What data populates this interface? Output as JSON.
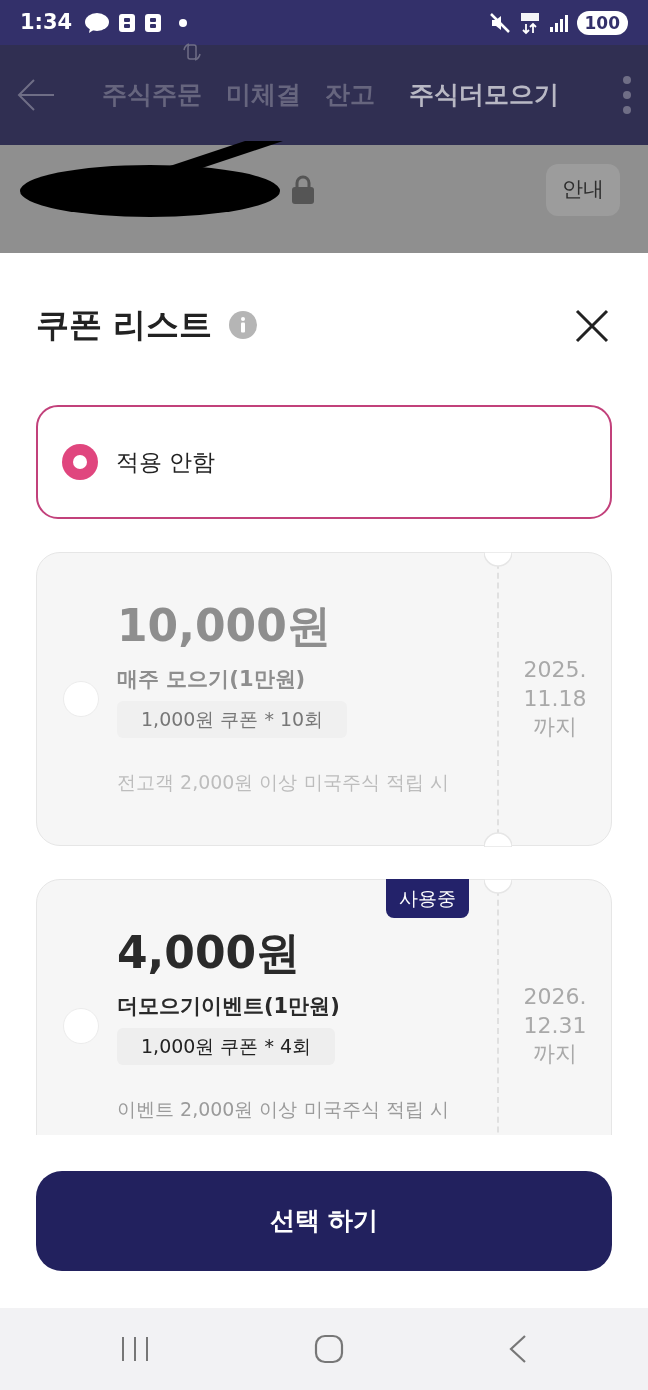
{
  "status_bar": {
    "time": "1:34",
    "battery": "100"
  },
  "app_bar": {
    "tabs": [
      {
        "label": "주식주문",
        "selected": false
      },
      {
        "label": "미체결",
        "selected": false
      },
      {
        "label": "잔고",
        "selected": false
      },
      {
        "label": "주식더모으기",
        "selected": true
      }
    ]
  },
  "info_bar": {
    "button": "안내"
  },
  "sheet": {
    "title": "쿠폰 리스트",
    "options": [
      {
        "kind": "none",
        "label": "적용 안함",
        "selected": true
      },
      {
        "kind": "coupon",
        "amount": "10,000원",
        "name": "매주 모으기(1만원)",
        "detail": "1,000원 쿠폰 * 10회",
        "condition": "전고객 2,000원 이상 미국주식 적립 시",
        "expiry": [
          "2025.",
          "11.18",
          "까지"
        ],
        "disabled": true,
        "selected": false
      },
      {
        "kind": "coupon",
        "amount": "4,000원",
        "name": "더모으기이벤트(1만원)",
        "detail": "1,000원 쿠폰 * 4회",
        "condition": "이벤트 2,000원 이상 미국주식 적립 시",
        "expiry": [
          "2026.",
          "12.31",
          "까지"
        ],
        "badge": "사용중",
        "disabled": false,
        "selected": false
      }
    ],
    "submit": "선택 하기"
  }
}
